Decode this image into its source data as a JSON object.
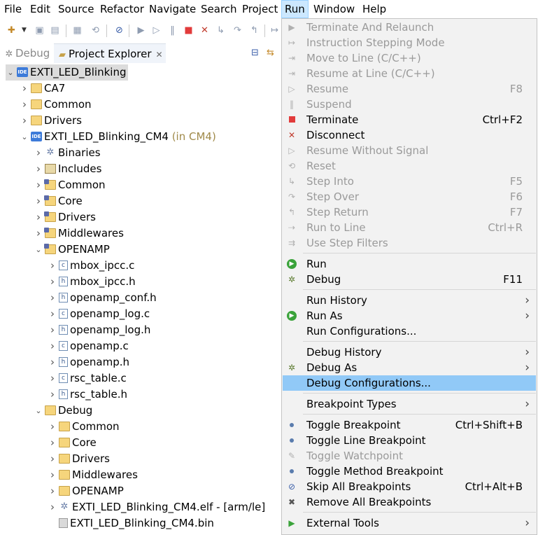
{
  "menubar": {
    "items": [
      "File",
      "Edit",
      "Source",
      "Refactor",
      "Navigate",
      "Search",
      "Project",
      "Run",
      "Window",
      "Help"
    ],
    "active": "Run"
  },
  "views": {
    "tabs": [
      {
        "label": "Debug",
        "icon": "bug-icon",
        "selected": false
      },
      {
        "label": "Project Explorer",
        "icon": "folder-icon",
        "selected": true
      }
    ]
  },
  "tree": [
    {
      "label": "EXTI_LED_Blinking",
      "depth": 0,
      "expander": "open",
      "icon": "ide-project-icon",
      "selected": true
    },
    {
      "label": "CA7",
      "depth": 1,
      "expander": "closed",
      "icon": "folder-icon"
    },
    {
      "label": "Common",
      "depth": 1,
      "expander": "closed",
      "icon": "folder-icon"
    },
    {
      "label": "Drivers",
      "depth": 1,
      "expander": "closed",
      "icon": "folder-icon"
    },
    {
      "label": "EXTI_LED_Blinking_CM4",
      "decoration": "(in CM4)",
      "depth": 1,
      "expander": "open",
      "icon": "ide-project-icon"
    },
    {
      "label": "Binaries",
      "depth": 2,
      "expander": "closed",
      "icon": "binaries-icon"
    },
    {
      "label": "Includes",
      "depth": 2,
      "expander": "closed",
      "icon": "includes-icon"
    },
    {
      "label": "Common",
      "depth": 2,
      "expander": "closed",
      "icon": "source-folder-icon"
    },
    {
      "label": "Core",
      "depth": 2,
      "expander": "closed",
      "icon": "source-folder-icon"
    },
    {
      "label": "Drivers",
      "depth": 2,
      "expander": "closed",
      "icon": "source-folder-icon"
    },
    {
      "label": "Middlewares",
      "depth": 2,
      "expander": "closed",
      "icon": "source-folder-icon"
    },
    {
      "label": "OPENAMP",
      "depth": 2,
      "expander": "open",
      "icon": "source-folder-icon"
    },
    {
      "label": "mbox_ipcc.c",
      "depth": 3,
      "expander": "closed",
      "icon": "c-file-icon"
    },
    {
      "label": "mbox_ipcc.h",
      "depth": 3,
      "expander": "closed",
      "icon": "h-file-icon"
    },
    {
      "label": "openamp_conf.h",
      "depth": 3,
      "expander": "closed",
      "icon": "h-file-icon"
    },
    {
      "label": "openamp_log.c",
      "depth": 3,
      "expander": "closed",
      "icon": "c-file-icon"
    },
    {
      "label": "openamp_log.h",
      "depth": 3,
      "expander": "closed",
      "icon": "h-file-icon"
    },
    {
      "label": "openamp.c",
      "depth": 3,
      "expander": "closed",
      "icon": "c-file-icon"
    },
    {
      "label": "openamp.h",
      "depth": 3,
      "expander": "closed",
      "icon": "h-file-icon"
    },
    {
      "label": "rsc_table.c",
      "depth": 3,
      "expander": "closed",
      "icon": "c-file-icon"
    },
    {
      "label": "rsc_table.h",
      "depth": 3,
      "expander": "closed",
      "icon": "h-file-icon"
    },
    {
      "label": "Debug",
      "depth": 2,
      "expander": "open",
      "icon": "folder-icon"
    },
    {
      "label": "Common",
      "depth": 3,
      "expander": "closed",
      "icon": "folder-icon"
    },
    {
      "label": "Core",
      "depth": 3,
      "expander": "closed",
      "icon": "folder-icon"
    },
    {
      "label": "Drivers",
      "depth": 3,
      "expander": "closed",
      "icon": "folder-icon"
    },
    {
      "label": "Middlewares",
      "depth": 3,
      "expander": "closed",
      "icon": "folder-icon"
    },
    {
      "label": "OPENAMP",
      "depth": 3,
      "expander": "closed",
      "icon": "folder-icon"
    },
    {
      "label": "EXTI_LED_Blinking_CM4.elf - [arm/le]",
      "depth": 3,
      "expander": "closed",
      "icon": "elf-binary-icon"
    },
    {
      "label": "EXTI_LED_Blinking_CM4.bin",
      "depth": 3,
      "expander": "none",
      "icon": "bin-file-icon"
    }
  ],
  "run_menu": [
    {
      "label": "Terminate And Relaunch",
      "icon": "terminate-relaunch-icon",
      "disabled": true
    },
    {
      "label": "Instruction Stepping Mode",
      "icon": "instruction-step-icon",
      "disabled": true
    },
    {
      "label": "Move to Line (C/C++)",
      "icon": "move-to-line-icon",
      "disabled": true
    },
    {
      "label": "Resume at Line (C/C++)",
      "icon": "resume-at-line-icon",
      "disabled": true
    },
    {
      "label": "Resume",
      "accel": "F8",
      "icon": "resume-icon",
      "disabled": true
    },
    {
      "label": "Suspend",
      "icon": "suspend-icon",
      "disabled": true
    },
    {
      "label": "Terminate",
      "accel": "Ctrl+F2",
      "icon": "terminate-icon",
      "disabled": false
    },
    {
      "label": "Disconnect",
      "icon": "disconnect-icon",
      "disabled": false
    },
    {
      "label": "Resume Without Signal",
      "icon": "resume-without-signal-icon",
      "disabled": true
    },
    {
      "label": "Reset",
      "icon": "reset-icon",
      "disabled": true
    },
    {
      "label": "Step Into",
      "accel": "F5",
      "icon": "step-into-icon",
      "disabled": true
    },
    {
      "label": "Step Over",
      "accel": "F6",
      "icon": "step-over-icon",
      "disabled": true
    },
    {
      "label": "Step Return",
      "accel": "F7",
      "icon": "step-return-icon",
      "disabled": true
    },
    {
      "label": "Run to Line",
      "accel": "Ctrl+R",
      "icon": "run-to-line-icon",
      "disabled": true
    },
    {
      "label": "Use Step Filters",
      "icon": "step-filters-icon",
      "disabled": true,
      "sep_after": true
    },
    {
      "label": "Run",
      "icon": "run-icon",
      "disabled": false
    },
    {
      "label": "Debug",
      "accel": "F11",
      "icon": "debug-bug-icon",
      "disabled": false,
      "sep_after": true
    },
    {
      "label": "Run History",
      "submenu": true,
      "disabled": false
    },
    {
      "label": "Run As",
      "submenu": true,
      "icon": "run-as-icon",
      "disabled": false
    },
    {
      "label": "Run Configurations...",
      "disabled": false,
      "sep_after": true
    },
    {
      "label": "Debug History",
      "submenu": true,
      "disabled": false
    },
    {
      "label": "Debug As",
      "submenu": true,
      "icon": "debug-as-icon",
      "disabled": false
    },
    {
      "label": "Debug Configurations...",
      "disabled": false,
      "highlighted": true,
      "sep_after": true
    },
    {
      "label": "Breakpoint Types",
      "submenu": true,
      "disabled": false,
      "sep_after": true
    },
    {
      "label": "Toggle Breakpoint",
      "accel": "Ctrl+Shift+B",
      "icon": "breakpoint-dot-icon",
      "disabled": false
    },
    {
      "label": "Toggle Line Breakpoint",
      "icon": "breakpoint-dot-icon",
      "disabled": false
    },
    {
      "label": "Toggle Watchpoint",
      "icon": "watchpoint-icon",
      "disabled": true
    },
    {
      "label": "Toggle Method Breakpoint",
      "icon": "breakpoint-dot-icon",
      "disabled": false
    },
    {
      "label": "Skip All Breakpoints",
      "accel": "Ctrl+Alt+B",
      "icon": "skip-breakpoints-icon",
      "disabled": false
    },
    {
      "label": "Remove All Breakpoints",
      "icon": "remove-breakpoints-icon",
      "disabled": false,
      "sep_after": true
    },
    {
      "label": "External Tools",
      "submenu": true,
      "icon": "external-tools-icon",
      "disabled": false
    }
  ],
  "colors": {
    "menu_highlight": "#91c9f7",
    "menubar_active": "#cce8ff",
    "tree_selection": "#dcdcdc",
    "disabled_text": "#9a9a9a",
    "decoration_text": "#a08a4a"
  }
}
